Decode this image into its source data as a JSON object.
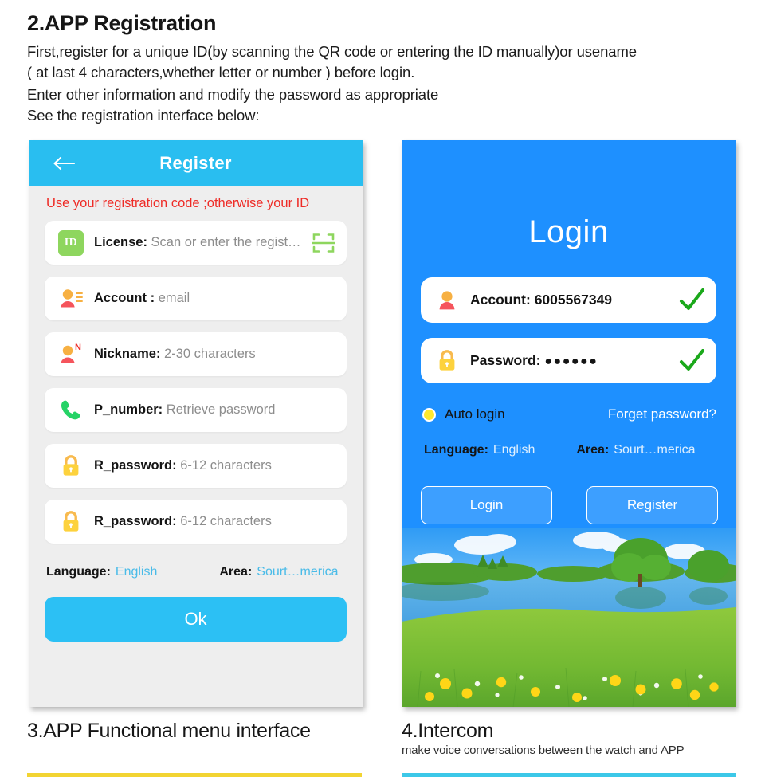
{
  "intro": {
    "title": "2.APP Registration",
    "lines": [
      "First,register for a unique ID(by scanning the QR code or entering the ID manually)or usename",
      "( at last 4 characters,whether letter or number ) before login.",
      "Enter other information and modify the password as appropriate",
      "See the registration interface below:"
    ]
  },
  "register": {
    "header_title": "Register",
    "back_icon": "back-arrow-icon",
    "warning": "Use your registration code ;otherwise your ID",
    "fields": [
      {
        "icon": "id-badge-icon",
        "badge_text": "ID",
        "label": "License:",
        "value": "Scan or enter the regist…",
        "trailing_icon": "qr-scan-icon"
      },
      {
        "icon": "contact-card-icon",
        "label": "Account :",
        "value": "email"
      },
      {
        "icon": "nickname-person-icon",
        "badge_text": "N",
        "label": "Nickname:",
        "value": "2-30 characters"
      },
      {
        "icon": "phone-icon",
        "label": "P_number:",
        "value": "Retrieve password"
      },
      {
        "icon": "lock-icon",
        "label": "R_password:",
        "value": "6-12 characters"
      },
      {
        "icon": "lock-icon",
        "label": "R_password:",
        "value": "6-12 characters"
      }
    ],
    "locale": {
      "language_label": "Language:",
      "language_value": "English",
      "area_label": "Area:",
      "area_value": "Sourt…merica"
    },
    "ok_label": "Ok"
  },
  "login": {
    "title": "Login",
    "fields": [
      {
        "icon": "person-icon",
        "label": "Account:",
        "value": "6005567349",
        "status_icon": "green-check-icon"
      },
      {
        "icon": "lock-icon",
        "label": "Password:",
        "value": "●●●●●●",
        "status_icon": "green-check-icon"
      }
    ],
    "auto_login_label": "Auto login",
    "forget_password_label": "Forget password?",
    "locale": {
      "language_label": "Language:",
      "language_value": "English",
      "area_label": "Area:",
      "area_value": "Sourt…merica"
    },
    "login_button": "Login",
    "register_button": "Register"
  },
  "footer": {
    "left_title": "3.APP Functional menu interface",
    "right_title": "4.Intercom",
    "right_subtitle": "make voice conversations between the watch and APP"
  },
  "colors": {
    "register_header": "#29bef0",
    "login_background": "#1e90ff",
    "ok_button": "#2cc0f4",
    "warning_red": "#ee2b26",
    "link_blue": "#49bbe8",
    "accent_yellow": "#f2d432",
    "accent_cyan": "#3cc8e8",
    "id_badge_green": "#8ed65e",
    "check_green": "#1aa81a",
    "radio_yellow": "#ffe92e"
  }
}
